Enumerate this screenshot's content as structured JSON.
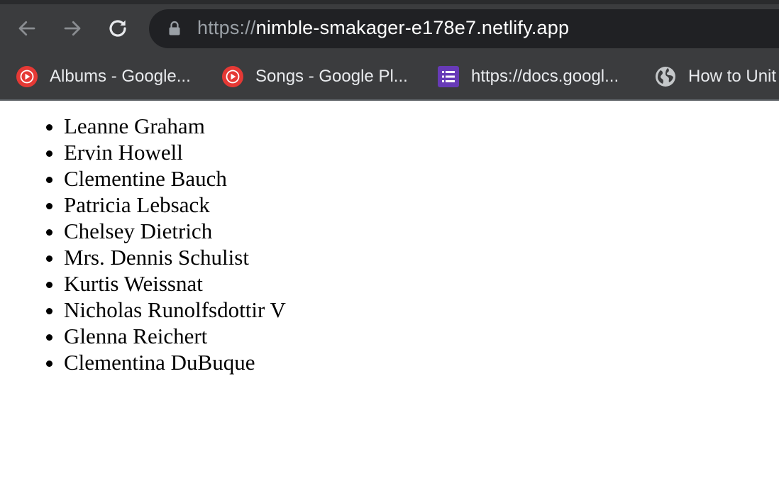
{
  "browser": {
    "url_scheme": "https://",
    "url_host": "nimble-smakager-e178e7.netlify.app",
    "bookmarks": [
      {
        "label": "Albums - Google...",
        "icon": "youtube-music-icon"
      },
      {
        "label": "Songs - Google Pl...",
        "icon": "youtube-music-icon"
      },
      {
        "label": "https://docs.googl...",
        "icon": "google-forms-icon"
      },
      {
        "label": "How to Unit",
        "icon": "globe-icon"
      }
    ]
  },
  "page": {
    "users": [
      "Leanne Graham",
      "Ervin Howell",
      "Clementine Bauch",
      "Patricia Lebsack",
      "Chelsey Dietrich",
      "Mrs. Dennis Schulist",
      "Kurtis Weissnat",
      "Nicholas Runolfsdottir V",
      "Glenna Reichert",
      "Clementina DuBuque"
    ]
  },
  "colors": {
    "chrome_bg": "#3b3c3e",
    "omnibox_bg": "#202124",
    "youtube_red": "#e53935",
    "forms_purple": "#673ab7"
  }
}
